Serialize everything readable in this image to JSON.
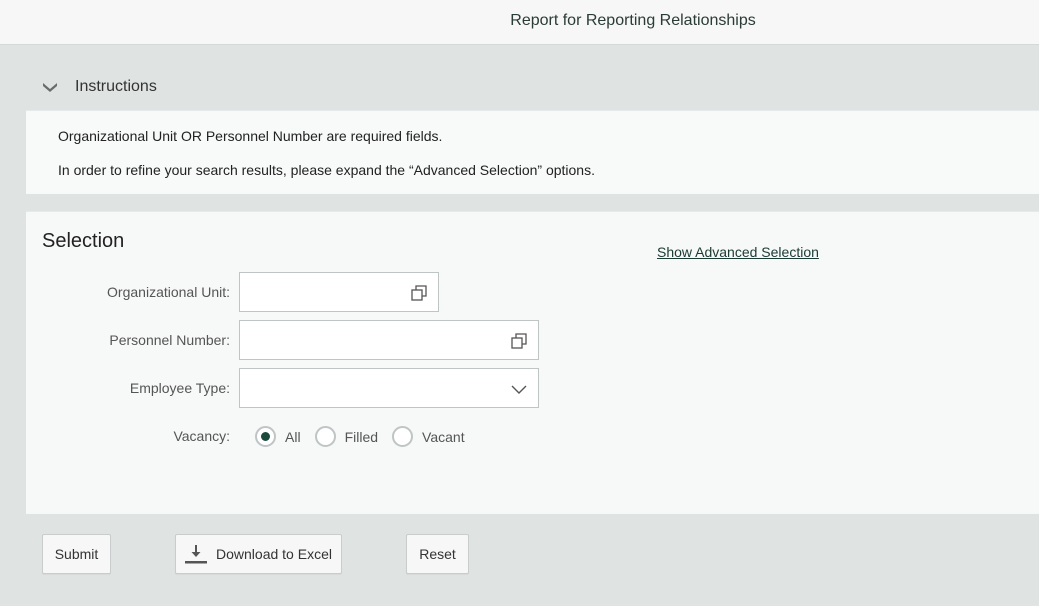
{
  "header": {
    "title": "Report for Reporting Relationships"
  },
  "instructions": {
    "title": "Instructions",
    "expanded": true,
    "lines": [
      "Organizational Unit OR Personnel Number are required fields.",
      "In order to refine your search results, please expand the “Advanced Selection” options."
    ]
  },
  "selection": {
    "title": "Selection",
    "advanced_link": "Show Advanced Selection",
    "fields": {
      "org_unit": {
        "label": "Organizational Unit:",
        "value": "",
        "icon": "value-help-icon"
      },
      "personnel_number": {
        "label": "Personnel Number:",
        "value": "",
        "icon": "value-help-icon"
      },
      "employee_type": {
        "label": "Employee Type:",
        "value": "",
        "icon": "chevron-down-icon"
      }
    },
    "vacancy": {
      "label": "Vacancy:",
      "options": [
        "All",
        "Filled",
        "Vacant"
      ],
      "selected": "All"
    }
  },
  "actions": {
    "submit": "Submit",
    "download": "Download to Excel",
    "reset": "Reset"
  },
  "colors": {
    "accent": "#1a4a3c",
    "background": "#dfe3e2",
    "panel": "#f7f8f8"
  }
}
